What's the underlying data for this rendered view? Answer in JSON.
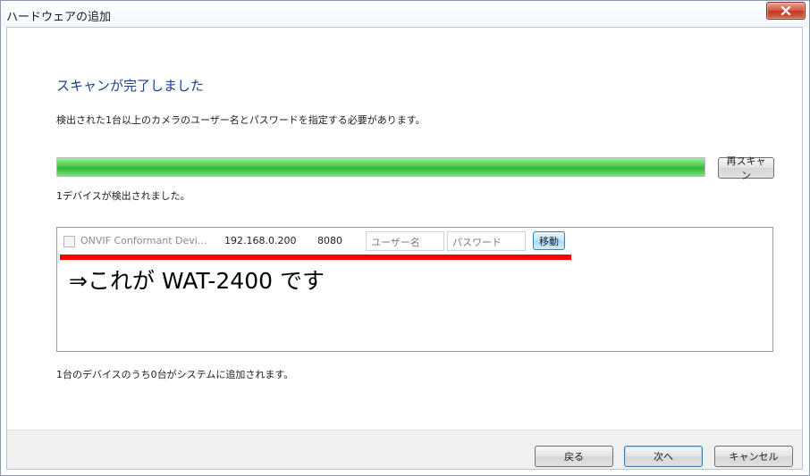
{
  "window": {
    "title": "ハードウェアの追加",
    "close_label": "x"
  },
  "header": {
    "title": "スキャンが完了しました",
    "instruction": "検出された1台以上のカメラのユーザー名とパスワードを指定する必要があります。"
  },
  "scan": {
    "progress_percent": 100,
    "rescan_label": "再スキャン",
    "detected_text": "1デバイスが検出されました。"
  },
  "device_list": {
    "devices": [
      {
        "name": "ONVIF Conformant Devi...",
        "ip": "192.168.0.200",
        "port": "8080",
        "username_placeholder": "ユーザー名",
        "password_placeholder": "パスワード",
        "move_label": "移動",
        "checked": false
      }
    ]
  },
  "annotation": {
    "text": "⇒これが WAT-2400 です",
    "color": "#ff0000"
  },
  "summary": {
    "text": "1台のデバイスのうち0台がシステムに追加されます。"
  },
  "footer": {
    "back_label": "戻る",
    "next_label": "次へ",
    "cancel_label": "キャンセル"
  },
  "colors": {
    "title_accent": "#1b3f8c",
    "progress": "#49c84d",
    "close_button": "#c0391f"
  }
}
